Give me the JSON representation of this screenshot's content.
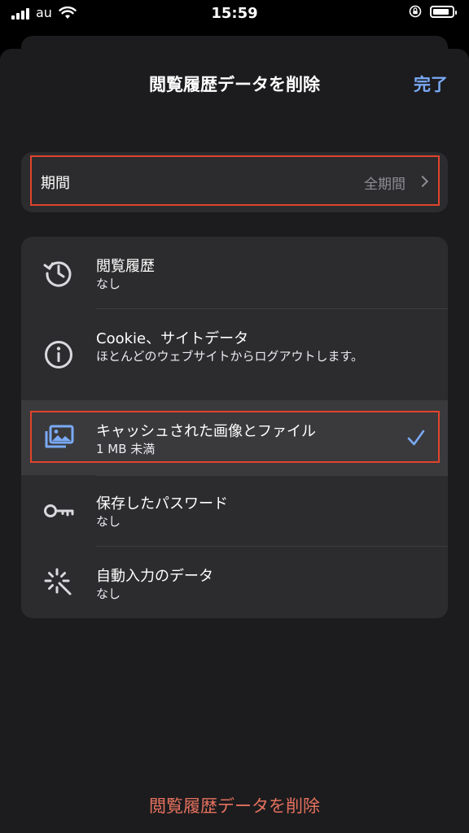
{
  "status_bar": {
    "carrier": "au",
    "time": "15:59"
  },
  "header": {
    "title": "閲覧履歴データを削除",
    "done_label": "完了"
  },
  "period": {
    "label": "期間",
    "value": "全期間"
  },
  "items": [
    {
      "icon": "history-icon",
      "title": "閲覧履歴",
      "subtitle": "なし",
      "selected": false
    },
    {
      "icon": "info-icon",
      "title": "Cookie、サイトデータ",
      "subtitle": "ほとんどのウェブサイトからログアウトします。",
      "selected": false
    },
    {
      "icon": "images-icon",
      "title": "キャッシュされた画像とファイル",
      "subtitle": "1 MB 未満",
      "selected": true
    },
    {
      "icon": "key-icon",
      "title": "保存したパスワード",
      "subtitle": "なし",
      "selected": false
    },
    {
      "icon": "magic-wand-icon",
      "title": "自動入力のデータ",
      "subtitle": "なし",
      "selected": false
    }
  ],
  "footer": {
    "delete_label": "閲覧履歴データを削除"
  },
  "colors": {
    "accent": "#7aaaf6",
    "destructive": "#e5715e",
    "highlight_outline": "#e0442c"
  }
}
